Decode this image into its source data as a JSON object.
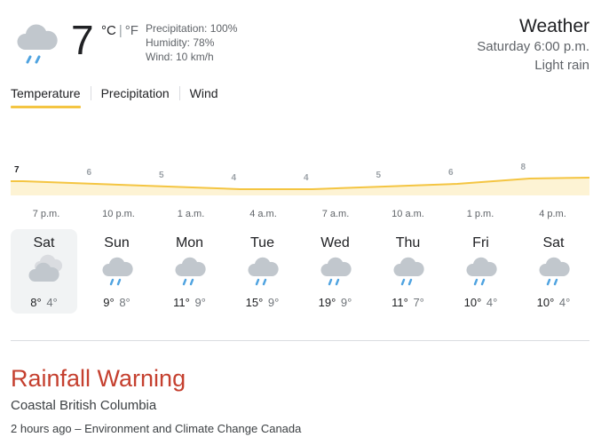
{
  "current": {
    "icon": "cloud-rain-icon",
    "temperature": "7",
    "unit_c": "°C",
    "unit_sep": "|",
    "unit_f": "°F",
    "precipitation": "Precipitation: 100%",
    "humidity": "Humidity: 78%",
    "wind": "Wind: 10 km/h"
  },
  "header": {
    "title": "Weather",
    "datetime": "Saturday 6:00 p.m.",
    "condition": "Light rain"
  },
  "tabs": [
    {
      "label": "Temperature",
      "active": true
    },
    {
      "label": "Precipitation",
      "active": false
    },
    {
      "label": "Wind",
      "active": false
    }
  ],
  "chart_data": {
    "type": "area",
    "series": [
      {
        "values": [
          7,
          6,
          5,
          4,
          4,
          5,
          6,
          8
        ]
      }
    ],
    "x_labels": [
      "7 p.m.",
      "10 p.m.",
      "1 a.m.",
      "4 a.m.",
      "7 a.m.",
      "10 a.m.",
      "1 p.m.",
      "4 p.m."
    ],
    "line_color": "#f4c542",
    "fill_color": "#fdf3d4"
  },
  "forecast": [
    {
      "day": "Sat",
      "icon": "partly-cloudy-icon",
      "high": "8°",
      "low": "4°",
      "selected": true
    },
    {
      "day": "Sun",
      "icon": "cloud-rain-icon",
      "high": "9°",
      "low": "8°",
      "selected": false
    },
    {
      "day": "Mon",
      "icon": "cloud-rain-icon",
      "high": "11°",
      "low": "9°",
      "selected": false
    },
    {
      "day": "Tue",
      "icon": "cloud-rain-icon",
      "high": "15°",
      "low": "9°",
      "selected": false
    },
    {
      "day": "Wed",
      "icon": "cloud-rain-icon",
      "high": "19°",
      "low": "9°",
      "selected": false
    },
    {
      "day": "Thu",
      "icon": "cloud-rain-icon",
      "high": "11°",
      "low": "7°",
      "selected": false
    },
    {
      "day": "Fri",
      "icon": "cloud-rain-icon",
      "high": "10°",
      "low": "4°",
      "selected": false
    },
    {
      "day": "Sat",
      "icon": "cloud-rain-icon",
      "high": "10°",
      "low": "4°",
      "selected": false
    }
  ],
  "warning": {
    "title": "Rainfall Warning",
    "region": "Coastal British Columbia",
    "source": "2 hours ago – Environment and Climate Change Canada"
  }
}
